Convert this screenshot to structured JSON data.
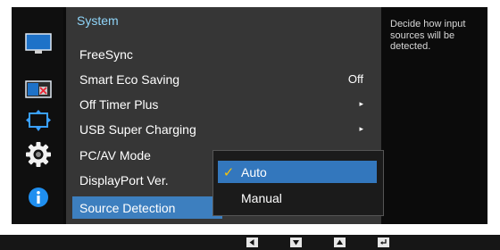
{
  "menu": {
    "title": "System",
    "items": [
      {
        "label": "FreeSync",
        "value": "",
        "arrow": ""
      },
      {
        "label": "Smart Eco Saving",
        "value": "Off",
        "arrow": ""
      },
      {
        "label": "Off Timer Plus",
        "value": "",
        "arrow": "▸"
      },
      {
        "label": "USB Super Charging",
        "value": "",
        "arrow": "▸"
      },
      {
        "label": "PC/AV Mode",
        "value": "",
        "arrow": ""
      },
      {
        "label": "DisplayPort Ver.",
        "value": "",
        "arrow": ""
      },
      {
        "label": "Source Detection",
        "value": "",
        "arrow": ""
      }
    ],
    "selected_item": "Source Detection"
  },
  "submenu": {
    "options": [
      {
        "label": "Auto",
        "checked": true
      },
      {
        "label": "Manual",
        "checked": false
      }
    ],
    "check_glyph": "✓"
  },
  "help": {
    "text": "Decide how input sources will be detected."
  },
  "sidebar": {
    "icons": [
      "picture-icon",
      "color-icon",
      "size-position-icon",
      "system-settings-icon",
      "information-icon"
    ],
    "active": "system-settings-icon"
  },
  "nav": {
    "keys": [
      "left-key-icon",
      "down-key-icon",
      "up-key-icon",
      "enter-key-icon"
    ]
  },
  "colors": {
    "highlight": "#3d7fbf",
    "title": "#8fd4f8",
    "check": "#f3c20d"
  }
}
